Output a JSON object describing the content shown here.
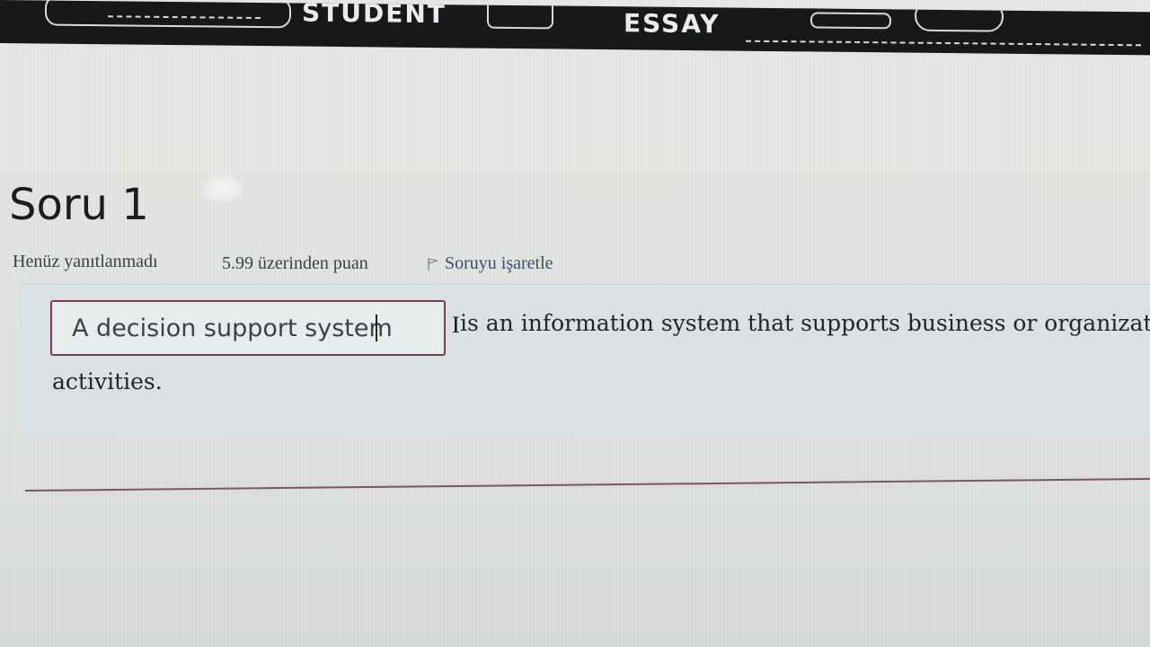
{
  "banner": {
    "word_left": "STUDENT",
    "word_right": "ESSAY"
  },
  "question": {
    "title": "Soru 1",
    "status": "Henüz yanıtlanmadı",
    "points": "5.99 üzerinden puan",
    "flag_label": "Soruyu işaretle",
    "answer_value": "A decision support system",
    "text_after_input": "is an information system that supports business or organizational",
    "text_line2": "activities."
  },
  "icons": {
    "flag": "flag-icon"
  },
  "colors": {
    "input_border": "#7a3d4e",
    "panel_bg": "#d8e2e4",
    "banner_bg": "#16181a"
  }
}
